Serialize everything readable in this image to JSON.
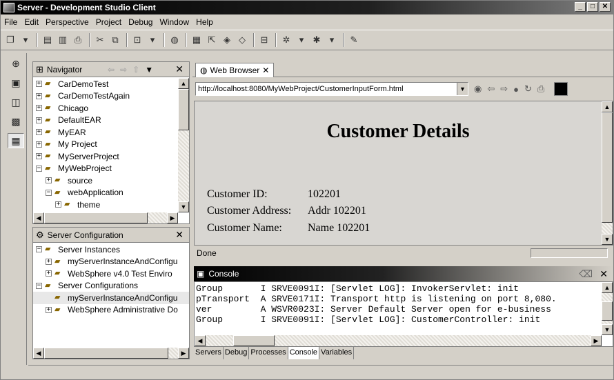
{
  "window": {
    "title": "Server - Development Studio Client"
  },
  "menu": [
    "File",
    "Edit",
    "Perspective",
    "Project",
    "Debug",
    "Window",
    "Help"
  ],
  "navigator": {
    "title": "Navigator",
    "items": [
      {
        "label": "CarDemoTest",
        "expander": "+",
        "indent": 0
      },
      {
        "label": "CarDemoTestAgain",
        "expander": "+",
        "indent": 0
      },
      {
        "label": "Chicago",
        "expander": "+",
        "indent": 0
      },
      {
        "label": "DefaultEAR",
        "expander": "+",
        "indent": 0
      },
      {
        "label": "MyEAR",
        "expander": "+",
        "indent": 0
      },
      {
        "label": "My Project",
        "expander": "+",
        "indent": 0
      },
      {
        "label": "MyServerProject",
        "expander": "+",
        "indent": 0
      },
      {
        "label": "MyWebProject",
        "expander": "−",
        "indent": 0
      },
      {
        "label": "source",
        "expander": "+",
        "indent": 1
      },
      {
        "label": "webApplication",
        "expander": "−",
        "indent": 1
      },
      {
        "label": "theme",
        "expander": "+",
        "indent": 2
      }
    ]
  },
  "server_config": {
    "title": "Server Configuration",
    "items": [
      {
        "label": "Server Instances",
        "expander": "−",
        "indent": 0
      },
      {
        "label": "myServerInstanceAndConfigu",
        "expander": "+",
        "indent": 1
      },
      {
        "label": "WebSphere v4.0 Test Enviro",
        "expander": "+",
        "indent": 1
      },
      {
        "label": "Server Configurations",
        "expander": "−",
        "indent": 0
      },
      {
        "label": "myServerInstanceAndConfigu",
        "expander": "",
        "indent": 1,
        "selected": true
      },
      {
        "label": "WebSphere Administrative Do",
        "expander": "+",
        "indent": 1
      }
    ]
  },
  "browser": {
    "tab_label": "Web Browser",
    "url": "http://localhost:8080/MyWebProject/CustomerInputForm.html",
    "page_title": "Customer Details",
    "fields": [
      {
        "key": "Customer ID:",
        "value": "102201"
      },
      {
        "key": "Customer Address:",
        "value": "Addr 102201"
      },
      {
        "key": "Customer Name:",
        "value": "Name 102201"
      }
    ],
    "status": "Done"
  },
  "console": {
    "title": "Console",
    "lines": [
      "Group       I SRVE0091I: [Servlet LOG]: InvokerServlet: init",
      "pTransport  A SRVE0171I: Transport http is listening on port 8,080.",
      "ver         A WSVR0023I: Server Default Server open for e-business",
      "Group       I SRVE0091I: [Servlet LOG]: CustomerController: init"
    ]
  },
  "bottom_tabs": [
    "Servers",
    "Debug",
    "Processes",
    "Console",
    "Variables"
  ]
}
